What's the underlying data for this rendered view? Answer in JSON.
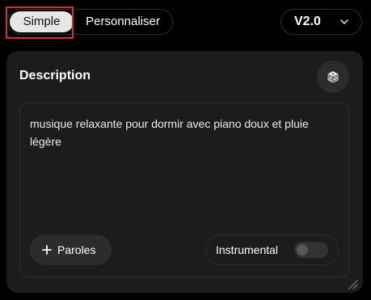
{
  "mode_tabs": {
    "simple_label": "Simple",
    "custom_label": "Personnaliser",
    "selected": "Simple"
  },
  "version": {
    "label": "V2.0",
    "icon": "chevron-down-icon"
  },
  "description_panel": {
    "title": "Description",
    "random_icon": "dice-icon",
    "text": "musique relaxante pour dormir avec piano doux et pluie légère",
    "lyrics_button_label": "Paroles",
    "lyrics_icon": "plus-icon",
    "instrumental_label": "Instrumental",
    "instrumental_enabled": false
  },
  "colors": {
    "background": "#000000",
    "panel": "#1c1c1e",
    "selected_tab": "#e6e6e6",
    "highlight": "#e0242c"
  }
}
